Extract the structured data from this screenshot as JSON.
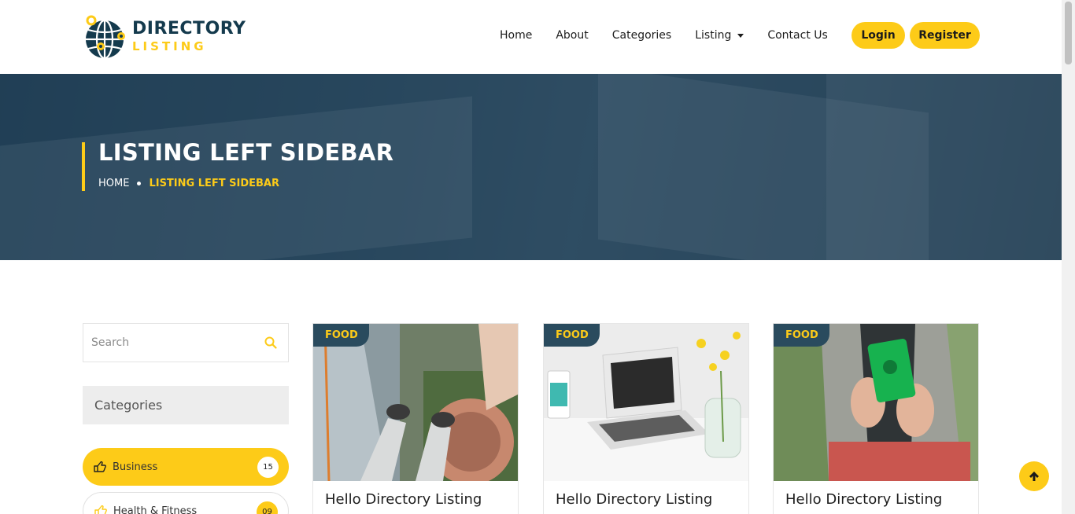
{
  "brand": {
    "line1": "DIRECTORY",
    "line2": "LISTING"
  },
  "nav": {
    "items": [
      "Home",
      "About",
      "Categories",
      "Listing",
      "Contact Us"
    ],
    "login": "Login",
    "register": "Register"
  },
  "banner": {
    "title": "LISTING LEFT SIDEBAR",
    "breadcrumb_home": "HOME",
    "breadcrumb_current": "LISTING LEFT SIDEBAR"
  },
  "sidebar": {
    "search_placeholder": "Search",
    "categories_heading": "Categories",
    "categories": [
      {
        "label": "Business",
        "count": "15"
      },
      {
        "label": "Health & Fitness",
        "count": "09"
      }
    ]
  },
  "listings": [
    {
      "tag": "FOOD",
      "title": "Hello Directory Listing"
    },
    {
      "tag": "FOOD",
      "title": "Hello Directory Listing"
    },
    {
      "tag": "FOOD",
      "title": "Hello Directory Listing"
    }
  ],
  "colors": {
    "accent": "#fdcb18",
    "dark": "#143a4d",
    "tag_bg": "#2a4b5e"
  }
}
